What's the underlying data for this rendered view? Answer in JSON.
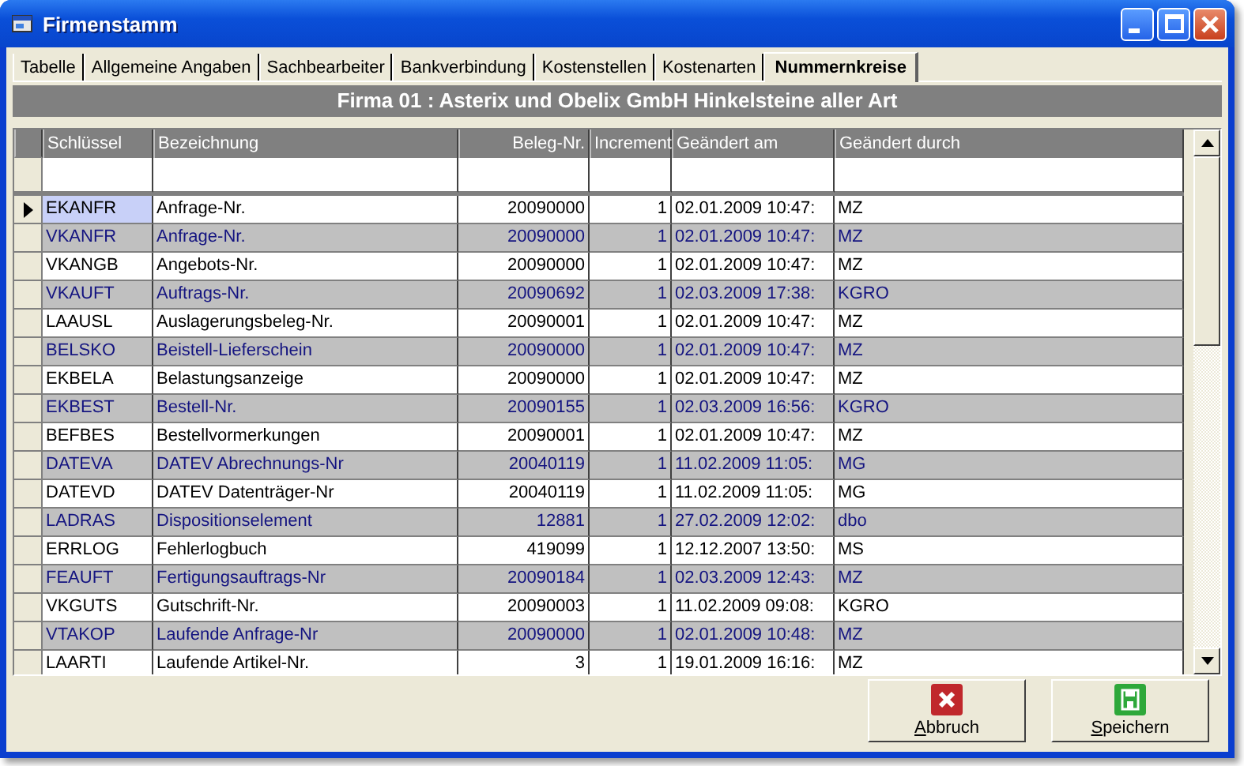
{
  "window": {
    "title": "Firmenstamm"
  },
  "tabs": [
    {
      "label": "Tabelle",
      "selected": false
    },
    {
      "label": "Allgemeine Angaben",
      "selected": false
    },
    {
      "label": "Sachbearbeiter",
      "selected": false
    },
    {
      "label": "Bankverbindung",
      "selected": false
    },
    {
      "label": "Kostenstellen",
      "selected": false
    },
    {
      "label": "Kostenarten",
      "selected": false
    },
    {
      "label": "Nummernkreise",
      "selected": true
    }
  ],
  "heading": "Firma 01 : Asterix und Obelix GmbH Hinkelsteine aller Art",
  "table": {
    "columns": [
      {
        "label": "Schlüssel"
      },
      {
        "label": "Bezeichnung"
      },
      {
        "label": "Beleg-Nr."
      },
      {
        "label": "Increment"
      },
      {
        "label": "Geändert am"
      },
      {
        "label": "Geändert durch"
      }
    ],
    "rows": [
      {
        "cells": [
          "EKANFR",
          "Anfrage-Nr.",
          "20090000",
          "1",
          "02.01.2009 10:47:",
          "MZ"
        ],
        "selected": true
      },
      {
        "cells": [
          "VKANFR",
          "Anfrage-Nr.",
          "20090000",
          "1",
          "02.01.2009 10:47:",
          "MZ"
        ],
        "selected": false
      },
      {
        "cells": [
          "VKANGB",
          "Angebots-Nr.",
          "20090000",
          "1",
          "02.01.2009 10:47:",
          "MZ"
        ],
        "selected": false
      },
      {
        "cells": [
          "VKAUFT",
          "Auftrags-Nr.",
          "20090692",
          "1",
          "02.03.2009 17:38:",
          "KGRO"
        ],
        "selected": false
      },
      {
        "cells": [
          "LAAUSL",
          "Auslagerungsbeleg-Nr.",
          "20090001",
          "1",
          "02.01.2009 10:47:",
          "MZ"
        ],
        "selected": false
      },
      {
        "cells": [
          "BELSKO",
          "Beistell-Lieferschein",
          "20090000",
          "1",
          "02.01.2009 10:47:",
          "MZ"
        ],
        "selected": false
      },
      {
        "cells": [
          "EKBELA",
          "Belastungsanzeige",
          "20090000",
          "1",
          "02.01.2009 10:47:",
          "MZ"
        ],
        "selected": false
      },
      {
        "cells": [
          "EKBEST",
          "Bestell-Nr.",
          "20090155",
          "1",
          "02.03.2009 16:56:",
          "KGRO"
        ],
        "selected": false
      },
      {
        "cells": [
          "BEFBES",
          "Bestellvormerkungen",
          "20090001",
          "1",
          "02.01.2009 10:47:",
          "MZ"
        ],
        "selected": false
      },
      {
        "cells": [
          "DATEVA",
          "DATEV Abrechnungs-Nr",
          "20040119",
          "1",
          "11.02.2009 11:05:",
          "MG"
        ],
        "selected": false
      },
      {
        "cells": [
          "DATEVD",
          "DATEV Datenträger-Nr",
          "20040119",
          "1",
          "11.02.2009 11:05:",
          "MG"
        ],
        "selected": false
      },
      {
        "cells": [
          "LADRAS",
          "Dispositionselement",
          "12881",
          "1",
          "27.02.2009 12:02:",
          "dbo"
        ],
        "selected": false
      },
      {
        "cells": [
          "ERRLOG",
          "Fehlerlogbuch",
          "419099",
          "1",
          "12.12.2007 13:50:",
          "MS"
        ],
        "selected": false
      },
      {
        "cells": [
          "FEAUFT",
          "Fertigungsauftrags-Nr",
          "20090184",
          "1",
          "02.03.2009 12:43:",
          "MZ"
        ],
        "selected": false
      },
      {
        "cells": [
          "VKGUTS",
          "Gutschrift-Nr.",
          "20090003",
          "1",
          "11.02.2009 09:08:",
          "KGRO"
        ],
        "selected": false
      },
      {
        "cells": [
          "VTAKOP",
          "Laufende Anfrage-Nr",
          "20090000",
          "1",
          "02.01.2009 10:48:",
          "MZ"
        ],
        "selected": false
      },
      {
        "cells": [
          "LAARTI",
          "Laufende Artikel-Nr.",
          "3",
          "1",
          "19.01.2009 16:16:",
          "MZ"
        ],
        "selected": false
      }
    ]
  },
  "buttons": [
    {
      "label": "Abbruch",
      "kind": "cancel"
    },
    {
      "label": "Speichern",
      "kind": "save"
    }
  ]
}
